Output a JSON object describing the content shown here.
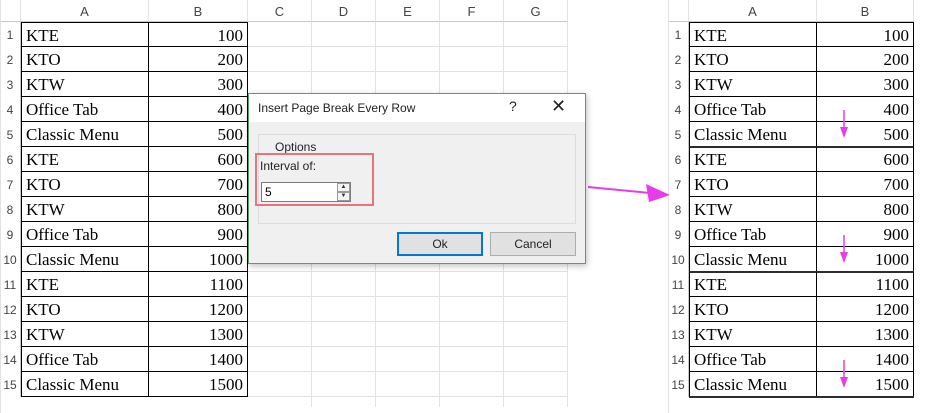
{
  "left_sheet": {
    "columns": [
      "A",
      "B",
      "C",
      "D",
      "E",
      "F",
      "G"
    ],
    "rows": [
      {
        "num": "1",
        "a": "KTE",
        "b": "100"
      },
      {
        "num": "2",
        "a": "KTO",
        "b": "200"
      },
      {
        "num": "3",
        "a": "KTW",
        "b": "300"
      },
      {
        "num": "4",
        "a": "Office Tab",
        "b": "400"
      },
      {
        "num": "5",
        "a": "Classic Menu",
        "b": "500"
      },
      {
        "num": "6",
        "a": "KTE",
        "b": "600"
      },
      {
        "num": "7",
        "a": "KTO",
        "b": "700"
      },
      {
        "num": "8",
        "a": "KTW",
        "b": "800"
      },
      {
        "num": "9",
        "a": "Office Tab",
        "b": "900"
      },
      {
        "num": "10",
        "a": "Classic Menu",
        "b": "1000"
      },
      {
        "num": "11",
        "a": "KTE",
        "b": "1100"
      },
      {
        "num": "12",
        "a": "KTO",
        "b": "1200"
      },
      {
        "num": "13",
        "a": "KTW",
        "b": "1300"
      },
      {
        "num": "14",
        "a": "Office Tab",
        "b": "1400"
      },
      {
        "num": "15",
        "a": "Classic Menu",
        "b": "1500"
      }
    ]
  },
  "right_sheet": {
    "columns": [
      "A",
      "B"
    ],
    "rows": [
      {
        "num": "1",
        "a": "KTE",
        "b": "100"
      },
      {
        "num": "2",
        "a": "KTO",
        "b": "200"
      },
      {
        "num": "3",
        "a": "KTW",
        "b": "300"
      },
      {
        "num": "4",
        "a": "Office Tab",
        "b": "400"
      },
      {
        "num": "5",
        "a": "Classic Menu",
        "b": "500"
      },
      {
        "num": "6",
        "a": "KTE",
        "b": "600"
      },
      {
        "num": "7",
        "a": "KTO",
        "b": "700"
      },
      {
        "num": "8",
        "a": "KTW",
        "b": "800"
      },
      {
        "num": "9",
        "a": "Office Tab",
        "b": "900"
      },
      {
        "num": "10",
        "a": "Classic Menu",
        "b": "1000"
      },
      {
        "num": "11",
        "a": "KTE",
        "b": "1100"
      },
      {
        "num": "12",
        "a": "KTO",
        "b": "1200"
      },
      {
        "num": "13",
        "a": "KTW",
        "b": "1300"
      },
      {
        "num": "14",
        "a": "Office Tab",
        "b": "1400"
      },
      {
        "num": "15",
        "a": "Classic Menu",
        "b": "1500"
      }
    ],
    "page_breaks_after_rows": [
      "5",
      "10",
      "15"
    ]
  },
  "dialog": {
    "title": "Insert Page Break Every Row",
    "help_label": "?",
    "close_label": "✕",
    "group_label": "Options",
    "interval_label": "Interval of:",
    "interval_value": "5",
    "ok_label": "Ok",
    "cancel_label": "Cancel"
  },
  "colors": {
    "annotation_arrow": "#e83ce8",
    "highlight_box": "#e8737a",
    "dialog_border": "#5b9c6a",
    "ok_focus": "#0078d7"
  },
  "icons": {
    "arrow": "arrow-right-icon",
    "break_marker": "arrow-down-icon"
  }
}
